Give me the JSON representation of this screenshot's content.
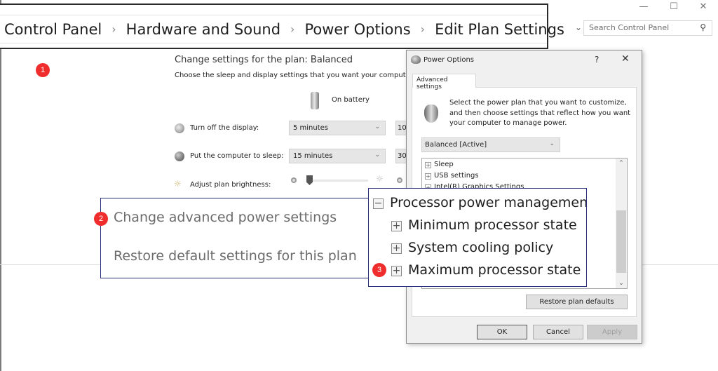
{
  "window": {
    "controls": {
      "minimize": "—",
      "maximize": "☐",
      "close": "✕"
    }
  },
  "address_bar": {
    "breadcrumb": [
      "Control Panel",
      "Hardware and Sound",
      "Power Options",
      "Edit Plan Settings"
    ],
    "separator": "›",
    "dropdown_glyph": "⌄",
    "refresh_glyph": "↻",
    "search_placeholder": "Search Control Panel",
    "search_glyph": "⚲"
  },
  "annotations": {
    "badge1": "1",
    "badge2": "2",
    "badge3": "3"
  },
  "plan": {
    "title": "Change settings for the plan: Balanced",
    "description": "Choose the sleep and display settings that you want your computer to use.",
    "column_header": "On battery",
    "rows": [
      {
        "label": "Turn off the display:",
        "on_battery": "5 minutes",
        "plugged_in": "10"
      },
      {
        "label": "Put the computer to sleep:",
        "on_battery": "15 minutes",
        "plugged_in": "30"
      },
      {
        "label": "Adjust plan brightness:",
        "brightness_percent": 10
      }
    ],
    "links": {
      "advanced": "Change advanced power settings",
      "restore": "Restore default settings for this plan"
    }
  },
  "dialog": {
    "title": "Power Options",
    "help": "?",
    "close": "✕",
    "tab": "Advanced settings",
    "description": "Select the power plan that you want to customize, and then choose settings that reflect how you want your computer to manage power.",
    "plan_select": "Balanced [Active]",
    "tree": [
      {
        "label": "Sleep",
        "state": "+"
      },
      {
        "label": "USB settings",
        "state": "+"
      },
      {
        "label": "Intel(R) Graphics Settings",
        "state": "+"
      }
    ],
    "tree_zoomed": [
      {
        "label": "Processor power management",
        "state": "−"
      },
      {
        "label": "Minimum processor state",
        "state": "+"
      },
      {
        "label": "System cooling policy",
        "state": "+"
      },
      {
        "label": "Maximum processor state",
        "state": "+"
      }
    ],
    "restore_button": "Restore plan defaults",
    "ok_button": "OK",
    "cancel_button": "Cancel",
    "apply_button": "Apply"
  }
}
